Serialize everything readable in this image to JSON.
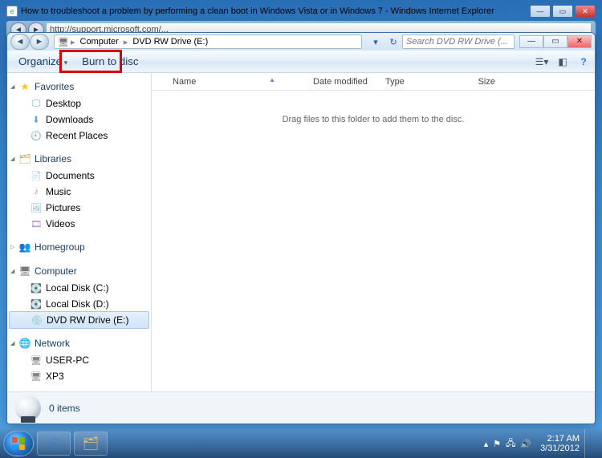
{
  "ie": {
    "title": "How to troubleshoot a problem by performing a clean boot in Windows Vista or in Windows 7 - Windows Internet Explorer",
    "address_blur": "http://support.microsoft.com/..."
  },
  "explorer": {
    "breadcrumb": {
      "root": "Computer",
      "leaf": "DVD RW Drive (E:)"
    },
    "search_placeholder": "Search DVD RW Drive (...",
    "toolbar": {
      "organize": "Organize",
      "burn": "Burn to disc"
    },
    "columns": {
      "name": "Name",
      "date": "Date modified",
      "type": "Type",
      "size": "Size"
    },
    "empty_hint": "Drag files to this folder to add them to the disc.",
    "sidebar": {
      "favorites": {
        "label": "Favorites",
        "items": [
          {
            "label": "Desktop",
            "ico": "desktop"
          },
          {
            "label": "Downloads",
            "ico": "download"
          },
          {
            "label": "Recent Places",
            "ico": "recent"
          }
        ]
      },
      "libraries": {
        "label": "Libraries",
        "items": [
          {
            "label": "Documents",
            "ico": "doc"
          },
          {
            "label": "Music",
            "ico": "music"
          },
          {
            "label": "Pictures",
            "ico": "pic"
          },
          {
            "label": "Videos",
            "ico": "vid"
          }
        ]
      },
      "homegroup": {
        "label": "Homegroup"
      },
      "computer": {
        "label": "Computer",
        "items": [
          {
            "label": "Local Disk (C:)",
            "ico": "disk"
          },
          {
            "label": "Local Disk (D:)",
            "ico": "disk"
          },
          {
            "label": "DVD RW Drive (E:)",
            "ico": "dvd",
            "selected": true
          }
        ]
      },
      "network": {
        "label": "Network",
        "items": [
          {
            "label": "USER-PC",
            "ico": "pc"
          },
          {
            "label": "XP3",
            "ico": "pc"
          }
        ]
      }
    },
    "status": "0 items"
  },
  "taskbar": {
    "time": "2:17 AM",
    "date": "3/31/2012"
  }
}
